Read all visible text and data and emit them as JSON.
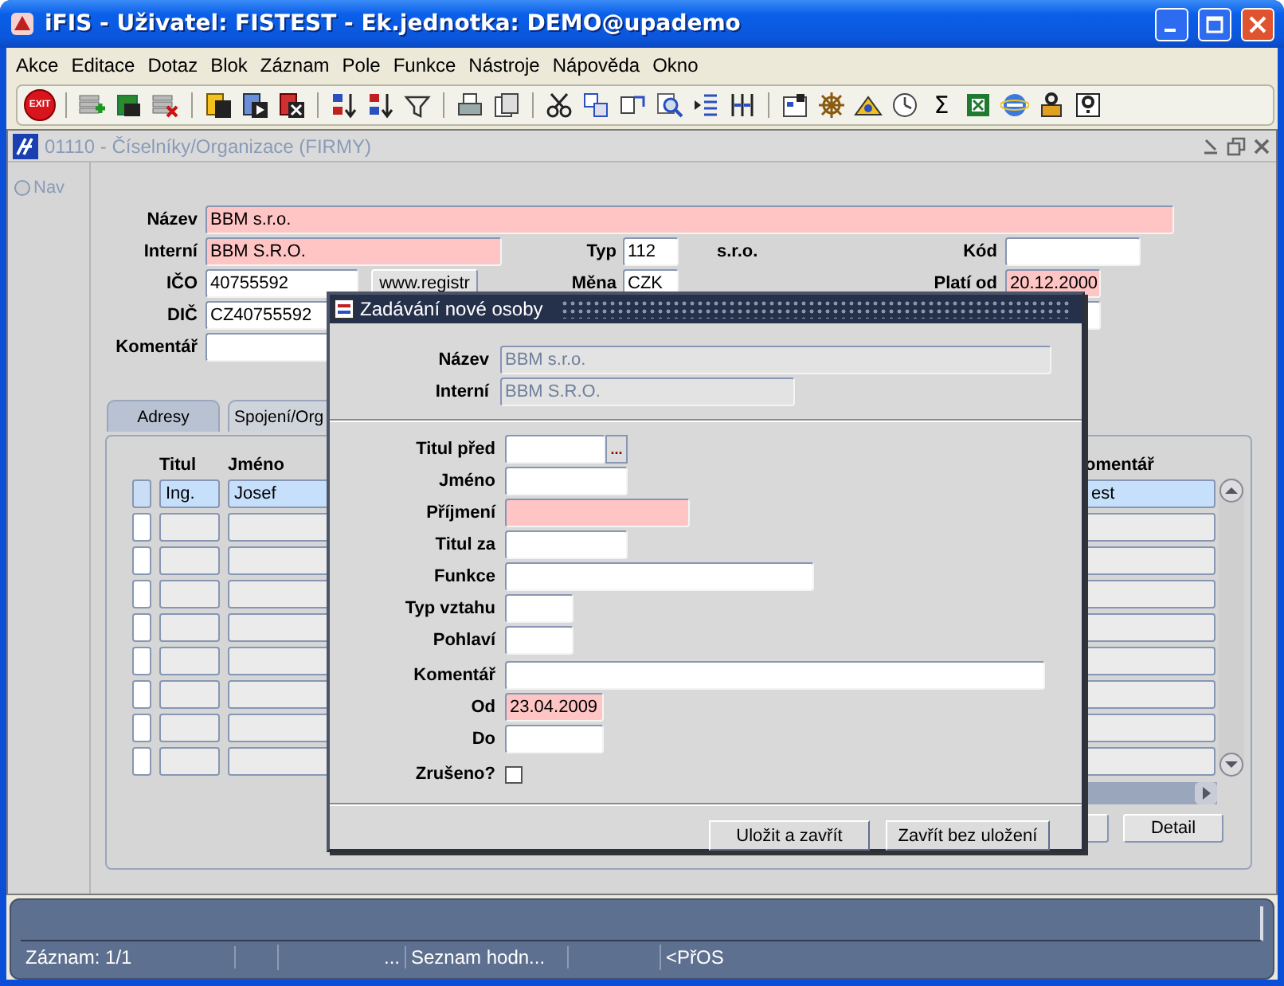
{
  "window": {
    "title": "iFIS - Uživatel: FISTEST - Ek.jednotka: DEMO@upademo"
  },
  "menu": [
    "Akce",
    "Editace",
    "Dotaz",
    "Blok",
    "Záznam",
    "Pole",
    "Funkce",
    "Nástroje",
    "Nápověda",
    "Okno"
  ],
  "toolbar": {
    "exit_label": "EXIT",
    "sum_label": "Σ"
  },
  "form_window": {
    "title": "01110 - Číselníky/Organizace (FIRMY)",
    "active": false
  },
  "nav": {
    "label": "Nav",
    "selected": false
  },
  "form": {
    "nazev": {
      "label": "Název",
      "value": "BBM s.r.o.",
      "required": true
    },
    "interni": {
      "label": "Interní",
      "value": "BBM S.R.O.",
      "required": true
    },
    "typ": {
      "label": "Typ",
      "value": "112",
      "required": false
    },
    "typ_name": "s.r.o.",
    "kod": {
      "label": "Kód",
      "required": false
    },
    "ico": {
      "label": "IČO",
      "value": "40755592",
      "required": false
    },
    "registr_button": "www.registr",
    "mena": {
      "label": "Měna",
      "value": "CZK",
      "required": false
    },
    "plati_od": {
      "label": "Platí od",
      "value": "20.12.2000",
      "required": true
    },
    "dic": {
      "label": "DIČ",
      "value": "CZ40755592",
      "required": false
    },
    "field_4": {
      "required": false
    },
    "komentar": {
      "label": "Komentář",
      "required": false
    }
  },
  "tabs": [
    {
      "label": "Adresy",
      "selected": true
    },
    {
      "label": "Spojení/Org",
      "selected": false
    }
  ],
  "table": {
    "columns": [
      "Titul",
      "Jméno",
      "omentář"
    ],
    "rows": [
      {
        "titul": "Ing.",
        "jmeno": "Josef",
        "column_3": "est",
        "selected": true
      },
      {
        "selected": false
      },
      {
        "selected": false
      },
      {
        "selected": false
      },
      {
        "selected": false
      },
      {
        "selected": false
      },
      {
        "selected": false
      },
      {
        "selected": false
      },
      {
        "selected": false
      }
    ]
  },
  "panel_buttons": [
    "Detail"
  ],
  "dialog": {
    "title": "Zadávání nové osoby",
    "header_fields": [
      {
        "label": "Název",
        "value": "BBM s.r.o.",
        "disabled": true
      },
      {
        "label": "Interní",
        "value": "BBM S.R.O.",
        "disabled": true
      }
    ],
    "fields": [
      {
        "label": "Titul před",
        "kind": "lov",
        "lov_label": "...",
        "required": false
      },
      {
        "label": "Jméno",
        "kind": "text",
        "required": false
      },
      {
        "label": "Příjmení",
        "kind": "text",
        "required": true
      },
      {
        "label": "Titul za",
        "kind": "text",
        "required": false
      },
      {
        "label": "Funkce",
        "kind": "text",
        "required": false
      },
      {
        "label": "Typ vztahu",
        "kind": "text",
        "required": false
      },
      {
        "label": "Pohlaví",
        "kind": "text",
        "required": false
      },
      {
        "label": "Komentář",
        "kind": "text",
        "required": false
      },
      {
        "label": "Od",
        "kind": "text",
        "value": "23.04.2009",
        "required": true
      },
      {
        "label": "Do",
        "kind": "text",
        "required": false
      },
      {
        "label": "Zrušeno?",
        "kind": "checkbox",
        "checked": false
      }
    ],
    "buttons": [
      "Uložit a zavřít",
      "Zavřít bez uložení"
    ]
  },
  "status_bar": {
    "cells": [
      "Záznam: 1/1",
      "...",
      "Seznam hodn...",
      "<PřOS"
    ]
  }
}
